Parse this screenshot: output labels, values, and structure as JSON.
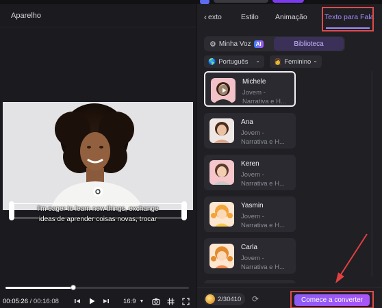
{
  "left_panel": {
    "title": "Aparelho",
    "subtitle_line1": "I'm eager to learn new things, exchange",
    "subtitle_line2": "ideas de aprender coisas novas, trocar",
    "time_current": "00:05:26",
    "time_separator": " / ",
    "time_total": "00:16:08",
    "aspect_ratio": "16:9",
    "progress": 0.37
  },
  "right_panel": {
    "tabs": [
      {
        "label": "Texto",
        "display": "exto"
      },
      {
        "label": "Estilo"
      },
      {
        "label": "Animação"
      },
      {
        "label": "Texto para Fala",
        "active": true
      }
    ],
    "voice_source": {
      "my_voice": "Minha Voz",
      "ai_badge": "AI",
      "library": "Biblioteca"
    },
    "filters": {
      "language": "Português",
      "gender": "Feminino"
    },
    "voices": [
      {
        "name": "Michele",
        "line1": "Jovem -",
        "line2": "Narrativa e H...",
        "selected": true
      },
      {
        "name": "Ana",
        "line1": "Jovem -",
        "line2": "Narrativa e H..."
      },
      {
        "name": "Keren",
        "line1": "Jovem -",
        "line2": "Narrativa e H..."
      },
      {
        "name": "Yasmin",
        "line1": "Jovem -",
        "line2": "Narrativa e H..."
      },
      {
        "name": "Carla",
        "line1": "Jovem -",
        "line2": "Narrativa e H..."
      }
    ],
    "credits": "2/30410",
    "convert_button": "Comece a converter"
  },
  "colors": {
    "accent": "#a855f7",
    "highlight_box": "#e04b4b"
  }
}
